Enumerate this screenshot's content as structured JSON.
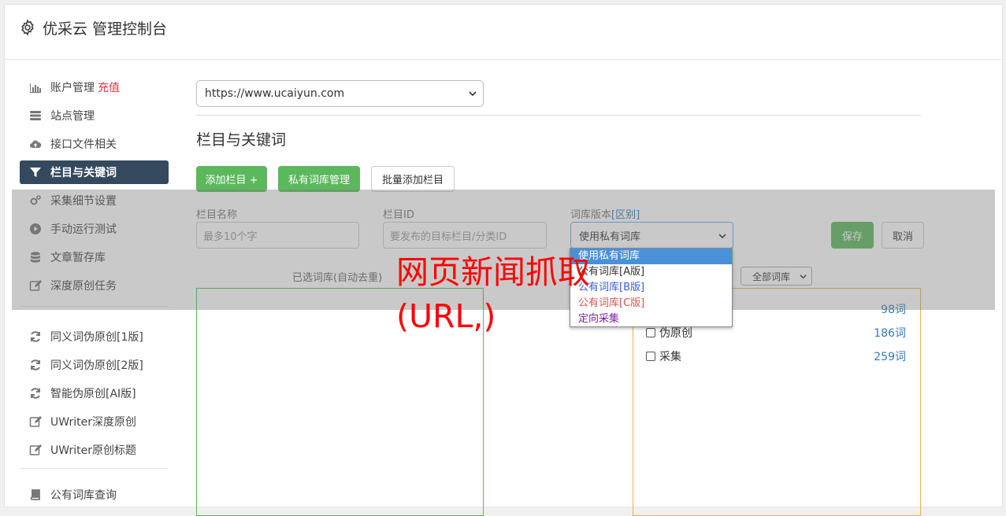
{
  "app": {
    "title": "优采云 管理控制台"
  },
  "sidebar": {
    "items": [
      {
        "label": "账户管理",
        "badge": "充值",
        "icon": "bar-chart-icon"
      },
      {
        "label": "站点管理",
        "icon": "server-icon"
      },
      {
        "label": "接口文件相关",
        "icon": "cloud-upload-icon"
      },
      {
        "label": "栏目与关键词",
        "icon": "filter-icon",
        "active": true
      },
      {
        "label": "采集细节设置",
        "icon": "cogs-icon"
      },
      {
        "label": "手动运行测试",
        "icon": "play-circle-icon"
      },
      {
        "label": "文章暂存库",
        "icon": "database-icon"
      },
      {
        "label": "深度原创任务",
        "icon": "edit-icon"
      },
      {
        "label": "同义词伪原创[1版]",
        "icon": "refresh-icon"
      },
      {
        "label": "同义词伪原创[2版]",
        "icon": "refresh-icon"
      },
      {
        "label": "智能伪原创[AI版]",
        "icon": "refresh-icon"
      },
      {
        "label": "UWriter深度原创",
        "icon": "edit-icon"
      },
      {
        "label": "UWriter原创标题",
        "icon": "edit-icon"
      },
      {
        "label": "公有词库查询",
        "icon": "book-icon"
      }
    ]
  },
  "main": {
    "site_select_value": "https://www.ucaiyun.com",
    "section_title": "栏目与关键词",
    "buttons": {
      "add_column": "添加栏目 +",
      "private_library": "私有词库管理",
      "batch_add": "批量添加栏目"
    },
    "form": {
      "name_label": "栏目名称",
      "name_placeholder": "最多10个字",
      "id_label": "栏目ID",
      "id_placeholder": "要发布的目标栏目/分类ID",
      "version_label": "词库版本",
      "version_link": "[区别]",
      "version_value": "使用私有词库",
      "save": "保存",
      "cancel": "取消"
    },
    "selected_label": "已选词库(自动去重)",
    "all_library_select": "全部词库",
    "libraries": [
      {
        "name": "",
        "count": "98词"
      },
      {
        "name": "伪原创",
        "count": "186词"
      },
      {
        "name": "采集",
        "count": "259词"
      }
    ],
    "dropdown": {
      "options": [
        {
          "label": "使用私有词库",
          "color": "#ffffff",
          "highlight": true
        },
        {
          "label": "公有词库[A版]",
          "color": "#333333"
        },
        {
          "label": "公有词库[B版]",
          "color": "#3b5bdb"
        },
        {
          "label": "公有词库[C版]",
          "color": "#d9534f"
        },
        {
          "label": "定向采集",
          "color": "#7b1fa2"
        }
      ]
    }
  },
  "watermark": {
    "text": "网页新闻抓取(URL,)"
  },
  "colors": {
    "accent": "#34495e",
    "green": "#5cb85c",
    "orange": "#f0ad4e",
    "link": "#337ab7",
    "red": "#e4353a"
  }
}
